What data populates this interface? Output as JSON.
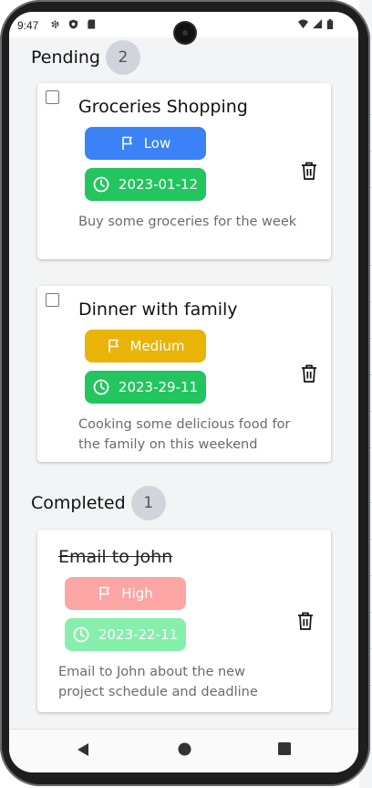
{
  "status_bar": {
    "time": "9:47"
  },
  "sections": [
    {
      "title": "Pending",
      "count": "2"
    },
    {
      "title": "Completed",
      "count": "1"
    }
  ],
  "tasks": [
    {
      "title": "Groceries Shopping",
      "priority": "Low",
      "date": "2023-01-12",
      "description": "Buy some groceries for the week",
      "completed": false
    },
    {
      "title": "Dinner with family",
      "priority": "Medium",
      "date": "2023-29-11",
      "description": "Cooking some delicious food for the family on this weekend",
      "completed": false
    },
    {
      "title": "Email to John",
      "priority": "High",
      "date": "2023-22-11",
      "description": "Email to John about the new project schedule and deadline",
      "completed": true
    }
  ],
  "colors": {
    "priority_low": "#3b82f6",
    "priority_medium": "#eab308",
    "priority_high": "#fca5a5",
    "date_active": "#22c55e",
    "date_done": "#86efac",
    "badge": "#d1d5db",
    "background": "#f3f4f6"
  },
  "icons": {
    "priority": "flag-icon",
    "date": "clock-icon",
    "delete": "trash-icon",
    "nav_back": "triangle-back-icon",
    "nav_home": "circle-home-icon",
    "nav_recents": "square-recents-icon"
  }
}
